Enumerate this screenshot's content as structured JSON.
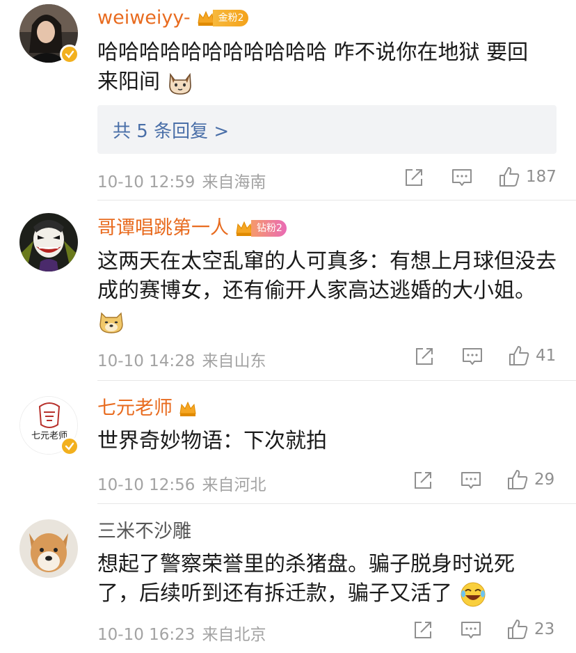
{
  "comments": [
    {
      "username": "weiweiyy-",
      "fan_badge": "金粉2",
      "text_line1": "哈哈哈哈哈哈哈哈哈哈哈 咋不说你在地狱 要回",
      "text_line2": "来阳间",
      "replies_label": "共 5 条回复 >",
      "time": "10-10 12:59",
      "location": "来自海南",
      "likes": "187"
    },
    {
      "username": "哥谭唱跳第一人",
      "fan_badge": "钻粉2",
      "text_line1": "这两天在太空乱窜的人可真多：有想上月球但没去",
      "text_line2": "成的赛博女，还有偷开人家高达逃婚的大小姐。",
      "time": "10-10 14:28",
      "location": "来自山东",
      "likes": "41"
    },
    {
      "username": "七元老师",
      "avatar_text": "七元老师",
      "text_line1": "世界奇妙物语：下次就拍",
      "time": "10-10 12:56",
      "location": "来自河北",
      "likes": "29"
    },
    {
      "username": "三米不沙雕",
      "text_line1": "想起了警察荣誉里的杀猪盘。骗子脱身时说死",
      "text_line2": "了，后续听到还有拆迁款，骗子又活了",
      "time": "10-10 16:23",
      "location": "来自北京",
      "likes": "23"
    }
  ],
  "colors": {
    "username": "#e86b1f",
    "link": "#4a6fa8",
    "meta": "#a3a3a3",
    "verified": "#f2b01e"
  },
  "icons": [
    "share-icon",
    "comment-icon",
    "like-icon",
    "crown-icon",
    "verified-icon",
    "cat-emoji",
    "doge-emoji",
    "laugh-cry-emoji"
  ]
}
